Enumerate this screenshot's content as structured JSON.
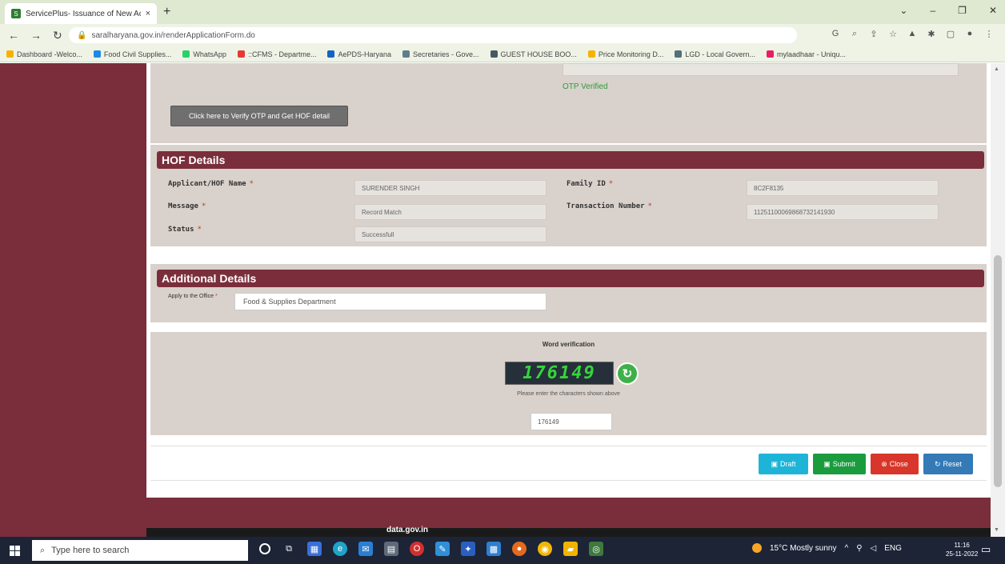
{
  "browser": {
    "tab_title": "ServicePlus- Issuance of New Ac",
    "tab_close": "×",
    "new_tab": "+",
    "window_controls": [
      "⌄",
      "–",
      "❐",
      "✕"
    ],
    "url": "saralharyana.gov.in/renderApplicationForm.do",
    "bookmarks": [
      {
        "label": "Dashboard -Welco...",
        "color": "#f5b301"
      },
      {
        "label": "Food Civil Supplies...",
        "color": "#1e88e5"
      },
      {
        "label": "WhatsApp",
        "color": "#25d366"
      },
      {
        "label": "::CFMS - Departme...",
        "color": "#e53935"
      },
      {
        "label": "AePDS-Haryana",
        "color": "#1565c0"
      },
      {
        "label": "Secretaries - Gove...",
        "color": "#607d8b"
      },
      {
        "label": "GUEST HOUSE BOO...",
        "color": "#455a64"
      },
      {
        "label": "Price Monitoring D...",
        "color": "#f5b301"
      },
      {
        "label": "LGD - Local Govern...",
        "color": "#546e7a"
      },
      {
        "label": "mylaadhaar - Uniqu...",
        "color": "#e91e63"
      }
    ]
  },
  "otp": {
    "verified_text": "OTP Verified",
    "verify_button": "Click here to Verify OTP and Get HOF detail"
  },
  "hof": {
    "header": "HOF Details",
    "applicant_label": "Applicant/HOF Name",
    "applicant_value": "SURENDER SINGH",
    "family_label": "Family ID",
    "family_value": "8C2F8135",
    "message_label": "Message",
    "message_value": "Record Match",
    "transaction_label": "Transaction Number",
    "transaction_value": "11251100069868732141930",
    "status_label": "Status",
    "status_value": "Successfull",
    "required_mark": "*"
  },
  "additional": {
    "header": "Additional Details",
    "office_label": "Apply to the Office",
    "office_value": "Food & Supplies Department"
  },
  "captcha": {
    "title": "Word verification",
    "code": "176149",
    "hint": "Please enter the characters shown above",
    "input_value": "176149"
  },
  "actions": {
    "draft": "Draft",
    "submit": "Submit",
    "close": "Close",
    "reset": "Reset"
  },
  "footer": {
    "logos_text": "data.gov.in"
  },
  "taskbar": {
    "search_placeholder": "Type here to search",
    "weather": "15°C  Mostly sunny",
    "lang": "ENG",
    "time": "11:16",
    "date": "25-11-2022"
  },
  "colors": {
    "maroon": "#7a2e3b",
    "panel": "#d9d1cb",
    "draft": "#1eb4d8",
    "submit": "#1a9c3e",
    "close": "#d9362b",
    "reset": "#337ab7"
  }
}
